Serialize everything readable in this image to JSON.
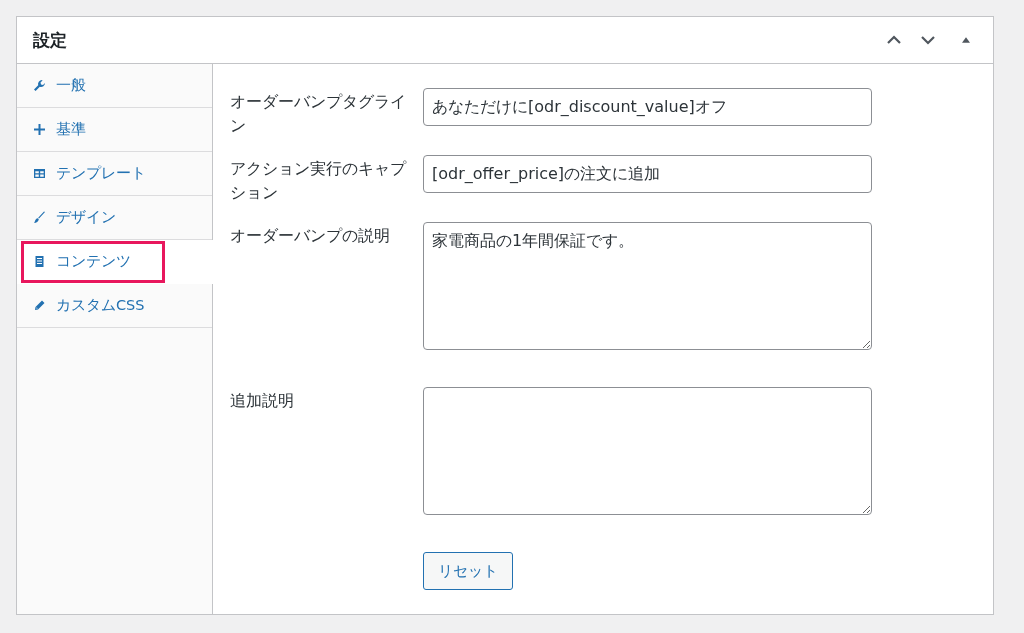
{
  "panel": {
    "title": "設定"
  },
  "tabs": [
    {
      "label": "一般",
      "kind": "wrench",
      "selected": false,
      "highlighted": false
    },
    {
      "label": "基準",
      "kind": "plus",
      "selected": false,
      "highlighted": false
    },
    {
      "label": "テンプレート",
      "kind": "table",
      "selected": false,
      "highlighted": false
    },
    {
      "label": "デザイン",
      "kind": "brush",
      "selected": false,
      "highlighted": false
    },
    {
      "label": "コンテンツ",
      "kind": "document",
      "selected": true,
      "highlighted": true
    },
    {
      "label": "カスタムCSS",
      "kind": "pencil",
      "selected": false,
      "highlighted": false
    }
  ],
  "fields": [
    {
      "label": "オーダーバンプタグライン",
      "kind": "input",
      "value": "あなただけに[odr_discount_value]オフ"
    },
    {
      "label": "アクション実行のキャプション",
      "kind": "input",
      "value": "[odr_offer_price]の注文に追加"
    },
    {
      "label": "オーダーバンプの説明",
      "kind": "textarea",
      "value": "家電商品の1年間保証です。"
    },
    {
      "label": "追加説明",
      "kind": "textarea"
    }
  ],
  "reset_button": "リセット"
}
